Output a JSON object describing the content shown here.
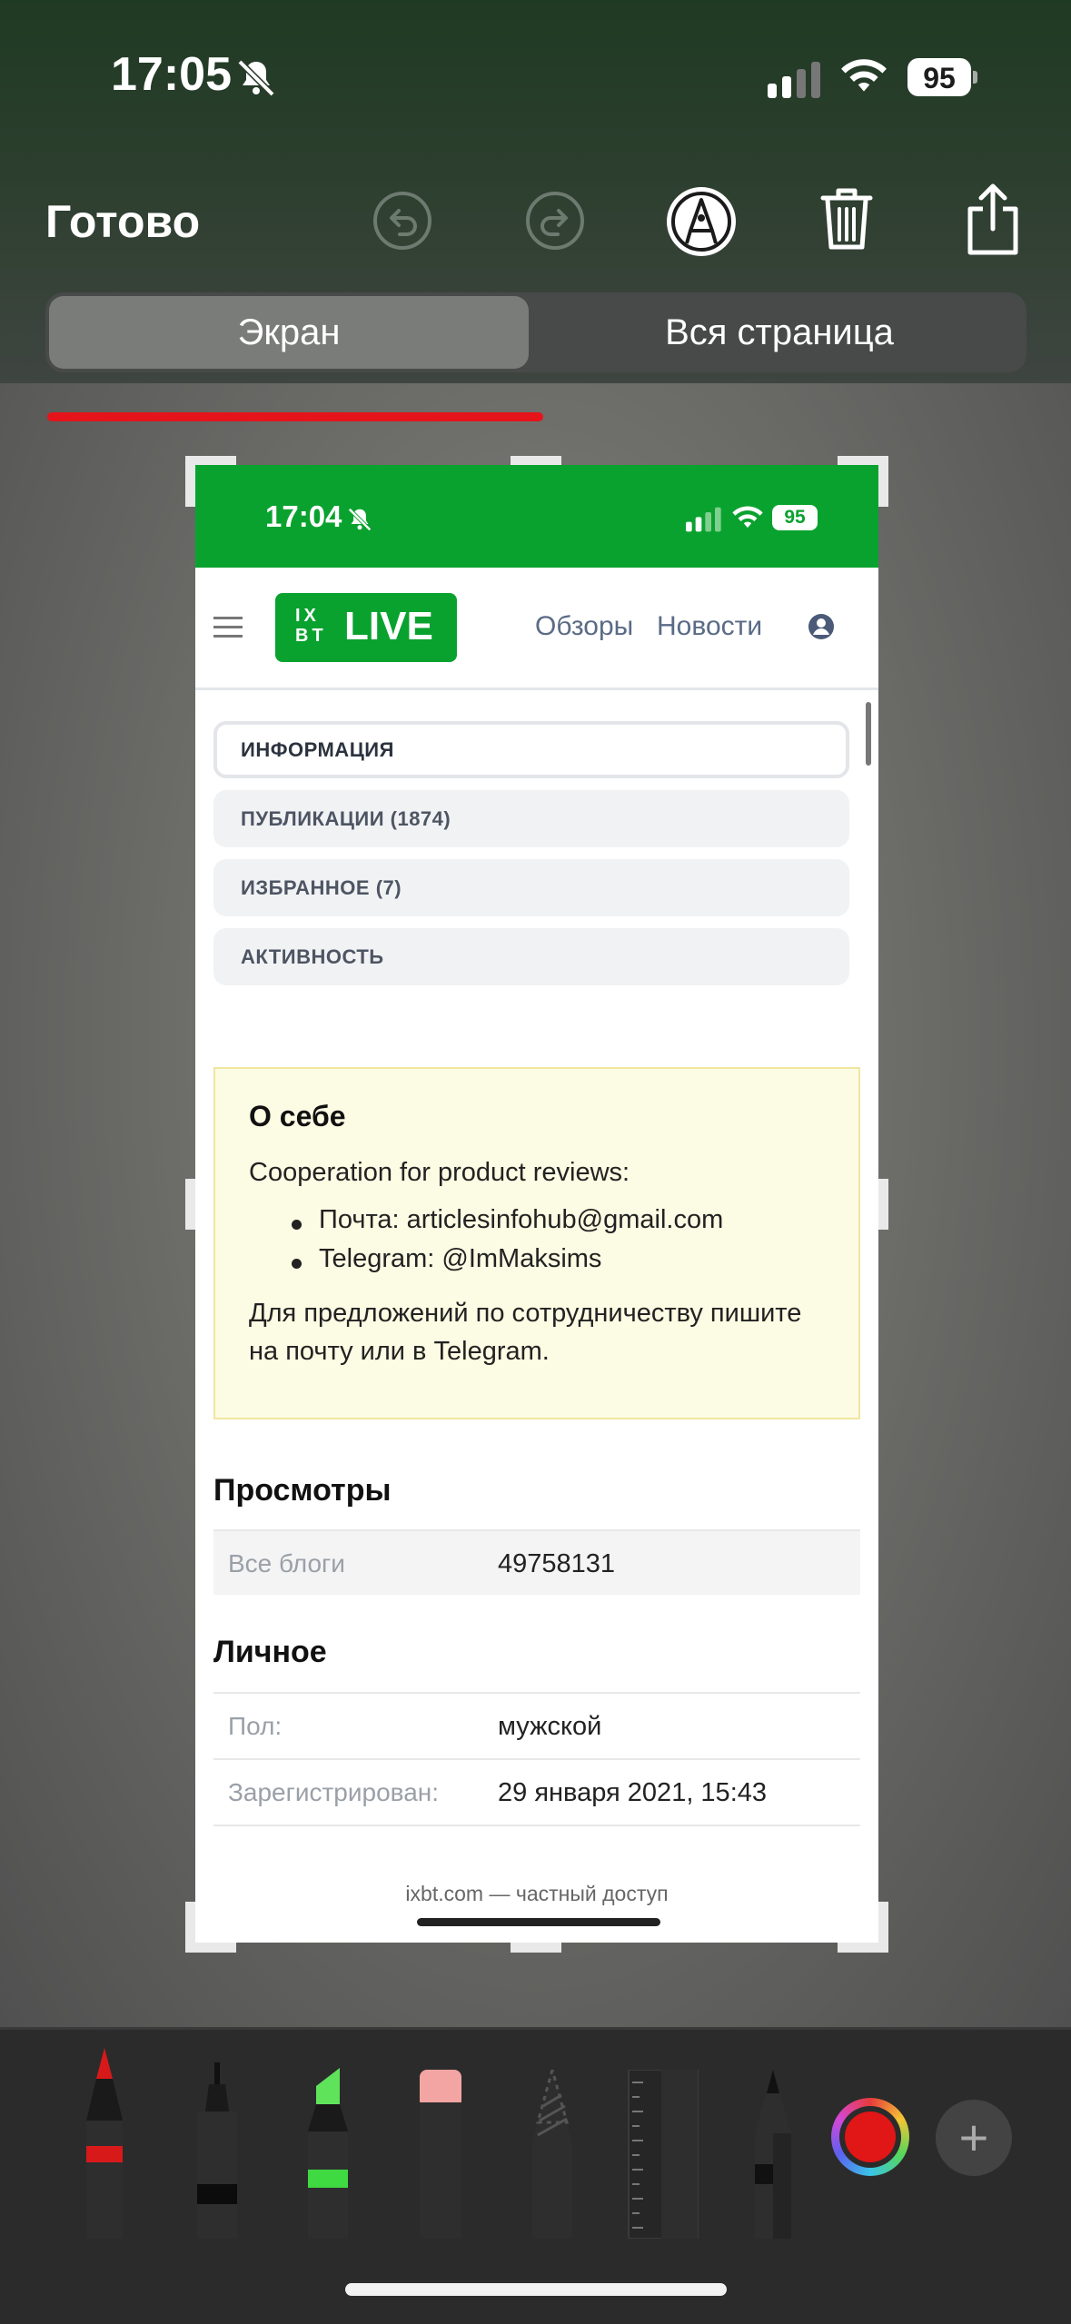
{
  "status_bar": {
    "time": "17:05",
    "battery": "95"
  },
  "toolbar": {
    "done_label": "Готово"
  },
  "segmented": {
    "screen_label": "Экран",
    "full_page_label": "Вся страница"
  },
  "preview": {
    "status_time": "17:04",
    "status_battery": "95",
    "logo_small": "IX BT",
    "logo_big": "LIVE",
    "nav": {
      "reviews": "Обзоры",
      "news": "Новости"
    },
    "tabs": [
      "ИНФОРМАЦИЯ",
      "ПУБЛИКАЦИИ (1874)",
      "ИЗБРАННОЕ (7)",
      "АКТИВНОСТЬ"
    ],
    "about": {
      "title": "О себе",
      "intro": "Cooperation for product reviews:",
      "items": [
        "Почта: articlesinfohub@gmail.com",
        "Telegram: @ImMaksims"
      ],
      "note": "Для предложений по сотрудничеству пишите на почту или в Telegram."
    },
    "views": {
      "title": "Просмотры",
      "rows": [
        {
          "key": "Все блоги",
          "value": "49758131"
        }
      ]
    },
    "personal": {
      "title": "Личное",
      "rows": [
        {
          "key": "Пол:",
          "value": "мужской"
        },
        {
          "key": "Зарегистрирован:",
          "value": "29 января 2021, 15:43"
        }
      ]
    },
    "footer": "ixbt.com — частный доступ"
  },
  "colors": {
    "site_green": "#0aa22f",
    "ink_red": "#e11616",
    "about_bg": "#fcfbe3"
  }
}
